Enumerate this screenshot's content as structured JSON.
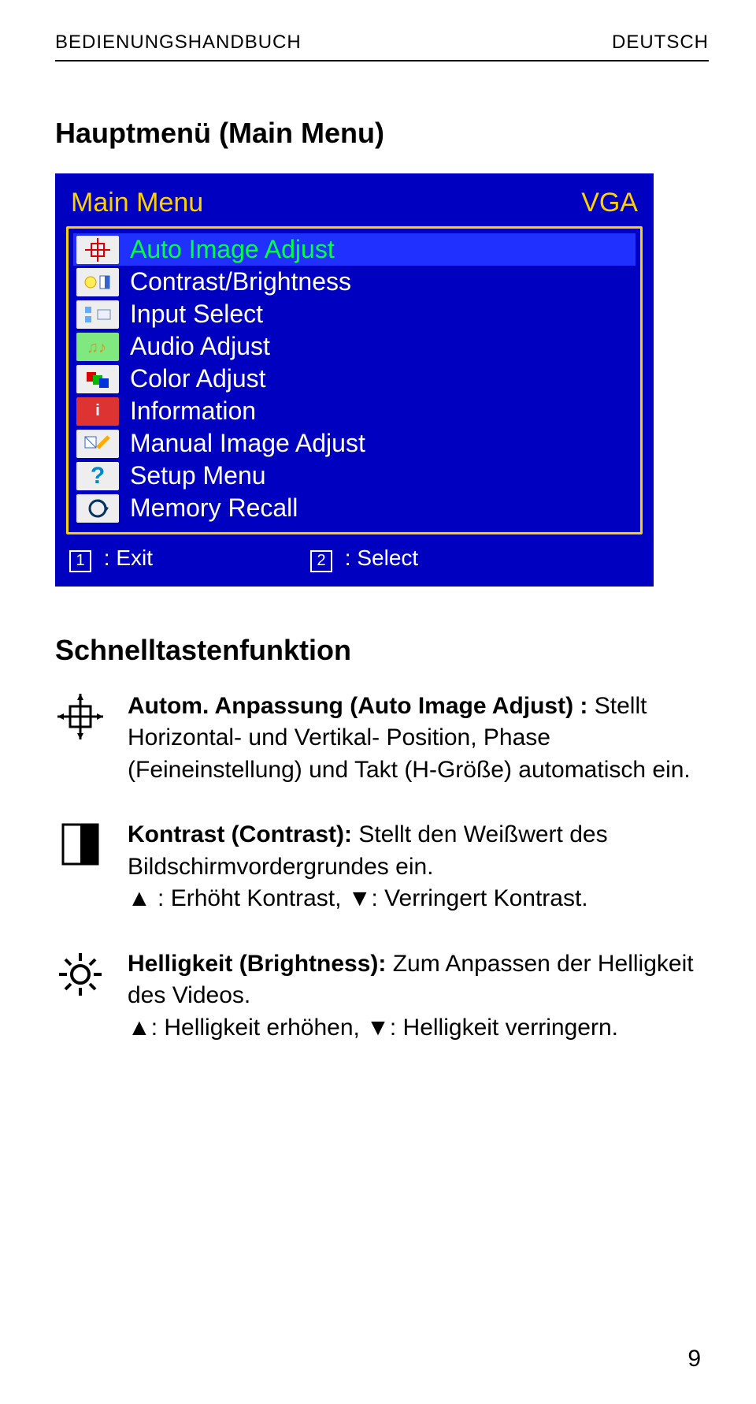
{
  "header": {
    "left": "BEDIENUNGSHANDBUCH",
    "right": "DEUTSCH"
  },
  "section1_title": "Hauptmenü (Main Menu)",
  "osd": {
    "title": "Main Menu",
    "mode": "VGA",
    "items": [
      {
        "icon": "target",
        "label": "Auto Image Adjust",
        "selected": true
      },
      {
        "icon": "bright-contrast",
        "label": "Contrast/Brightness",
        "selected": false
      },
      {
        "icon": "input",
        "label": "Input Select",
        "selected": false
      },
      {
        "icon": "audio",
        "label": "Audio Adjust",
        "selected": false
      },
      {
        "icon": "rgb",
        "label": "Color Adjust",
        "selected": false
      },
      {
        "icon": "info",
        "label": "Information",
        "selected": false
      },
      {
        "icon": "manual",
        "label": "Manual Image Adjust",
        "selected": false
      },
      {
        "icon": "setup",
        "label": "Setup Menu",
        "selected": false
      },
      {
        "icon": "mem",
        "label": "Memory Recall",
        "selected": false
      }
    ],
    "foot": {
      "k1": "1",
      "k1_label": ": Exit",
      "k2": "2",
      "k2_label": ": Select"
    }
  },
  "section2_title": "Schnelltastenfunktion",
  "entries": [
    {
      "icon": "target-bw",
      "lead": "Autom. Anpassung (Auto Image Adjust) :",
      "rest": "Stellt Horizontal- und Vertikal- Position, Phase (Feineinstellung) und Takt (H-Größe) automatisch ein."
    },
    {
      "icon": "contrast-bw",
      "lead": "Kontrast (Contrast):",
      "rest": " Stellt den Weißwert des Bildschirmvordergrundes ein.",
      "line2": "▲ : Erhöht Kontrast, ▼: Verringert Kontrast."
    },
    {
      "icon": "sun-bw",
      "lead": "Helligkeit (Brightness):",
      "rest": " Zum Anpassen der Helligkeit des Videos.",
      "line2": "▲: Helligkeit erhöhen, ▼: Helligkeit verringern."
    }
  ],
  "page_number": "9"
}
